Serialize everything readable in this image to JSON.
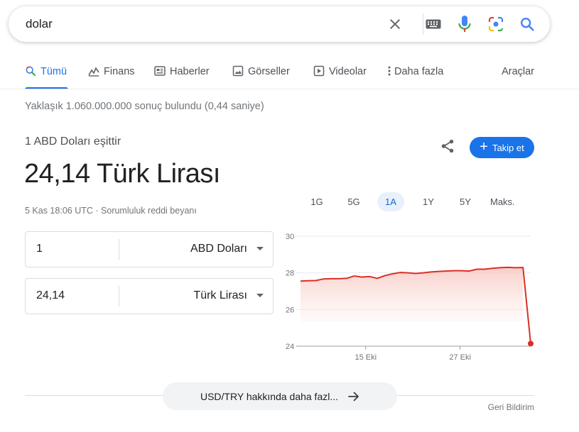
{
  "search": {
    "query": "dolar"
  },
  "icons": {
    "clear": "close-icon",
    "keyboard": "keyboard-icon",
    "voice": "microphone-icon",
    "lens": "camera-lens-icon",
    "search": "search-icon"
  },
  "tabs": [
    {
      "label": "Tümü",
      "icon": "search-icon",
      "active": true
    },
    {
      "label": "Finans",
      "icon": "finance-chart-icon"
    },
    {
      "label": "Haberler",
      "icon": "news-icon"
    },
    {
      "label": "Görseller",
      "icon": "image-icon"
    },
    {
      "label": "Videolar",
      "icon": "video-icon"
    },
    {
      "label": "Daha fazla",
      "icon": "more-vert-icon"
    }
  ],
  "tools_label": "Araçlar",
  "result_stats": "Yaklaşık 1.060.000.000 sonuç bulundu (0,44 saniye)",
  "currency": {
    "equals_label": "1 ABD Doları eşittir",
    "value": "24,14 Türk Lirası",
    "time": "5 Kas 18:06 UTC",
    "separator": "·",
    "disclaimer": "Sorumluluk reddi beyanı",
    "follow_label": "Takip et",
    "from": {
      "amount": "1",
      "currency": "ABD Doları"
    },
    "to": {
      "amount": "24,14",
      "currency": "Türk Lirası"
    }
  },
  "ranges": [
    {
      "label": "1G"
    },
    {
      "label": "5G"
    },
    {
      "label": "1A",
      "active": true
    },
    {
      "label": "1Y"
    },
    {
      "label": "5Y"
    },
    {
      "label": "Maks."
    }
  ],
  "colors": {
    "accent": "#1a73e8",
    "line": "#d93025",
    "fill": "#fce8e6"
  },
  "chart_data": {
    "type": "area",
    "x": [
      0,
      1,
      2,
      3,
      4,
      5,
      6,
      7,
      8,
      9,
      10,
      11,
      12,
      13,
      14,
      15,
      16,
      17,
      18,
      19,
      20,
      21,
      22,
      23,
      24,
      25,
      26,
      27,
      28,
      29,
      30
    ],
    "values": [
      27.55,
      27.57,
      27.58,
      27.67,
      27.68,
      27.68,
      27.7,
      27.83,
      27.77,
      27.8,
      27.7,
      27.85,
      27.95,
      28.02,
      28.0,
      27.97,
      28.0,
      28.05,
      28.08,
      28.1,
      28.12,
      28.12,
      28.1,
      28.2,
      28.2,
      28.25,
      28.28,
      28.3,
      28.28,
      28.29,
      24.14
    ],
    "x_ticks": [
      {
        "x": 8.5,
        "label": "15 Eki"
      },
      {
        "x": 20.8,
        "label": "27 Eki"
      }
    ],
    "y_ticks": [
      30,
      28,
      26,
      24
    ],
    "ylim": [
      24,
      30
    ],
    "grid": true
  },
  "more_button": "USD/TRY hakkında daha fazl...",
  "feedback": "Geri Bildirim"
}
